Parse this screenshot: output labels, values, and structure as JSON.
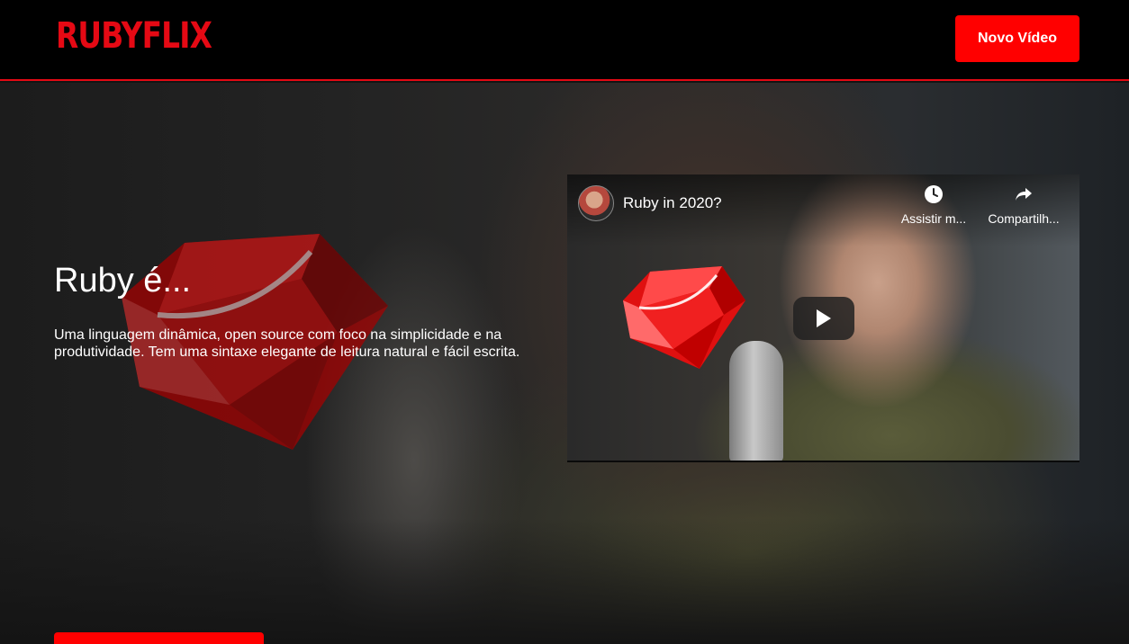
{
  "header": {
    "logo": "RUBYFLIX",
    "new_video_label": "Novo Vídeo"
  },
  "banner": {
    "title": "Ruby é...",
    "description": "Uma linguagem dinâmica, open source com foco na simplicidade e na produtividade. Tem uma sintaxe elegante de leitura natural e fácil escrita."
  },
  "video": {
    "title": "Ruby in 2020?",
    "watch_later_label": "Assistir m...",
    "share_label": "Compartilh..."
  },
  "colors": {
    "brand": "#e50914",
    "button": "#ff0000",
    "background": "#141414"
  },
  "icons": [
    "ruby-logo",
    "clock-icon",
    "share-icon",
    "play-icon"
  ]
}
